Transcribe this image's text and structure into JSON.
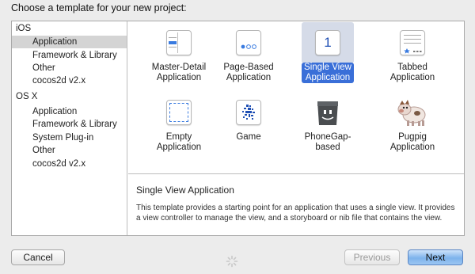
{
  "title": "Choose a template for your new project:",
  "sidebar": {
    "sections": [
      {
        "label": "iOS",
        "items": [
          "Application",
          "Framework & Library",
          "Other",
          "cocos2d v2.x"
        ]
      },
      {
        "label": "OS X",
        "items": [
          "Application",
          "Framework & Library",
          "System Plug-in",
          "Other",
          "cocos2d v2.x"
        ]
      }
    ],
    "selected": "iOS / Application"
  },
  "templates": [
    {
      "line1": "Master-Detail",
      "line2": "Application",
      "icon": "master-detail-icon"
    },
    {
      "line1": "Page-Based",
      "line2": "Application",
      "icon": "page-based-icon"
    },
    {
      "line1": "Single View",
      "line2": "Application",
      "icon": "single-view-icon",
      "icon_text": "1",
      "selected": true
    },
    {
      "line1": "Tabbed",
      "line2": "Application",
      "icon": "tabbed-icon"
    },
    {
      "line1": "Empty",
      "line2": "Application",
      "icon": "empty-icon"
    },
    {
      "line1": "Game",
      "line2": "",
      "icon": "game-icon"
    },
    {
      "line1": "PhoneGap-",
      "line2": "based",
      "icon": "phonegap-icon"
    },
    {
      "line1": "Pugpig",
      "line2": "Application",
      "icon": "pugpig-icon"
    }
  ],
  "description": {
    "title": "Single View Application",
    "body": "This template provides a starting point for an application that uses a single view. It provides a view controller to manage the view, and a storyboard or nib file that contains the view."
  },
  "buttons": {
    "cancel": "Cancel",
    "previous": "Previous",
    "next": "Next"
  },
  "colors": {
    "accent": "#3a6fd8",
    "selection_row": "#d4d4d4",
    "selection_tile": "#d5dbe8"
  }
}
